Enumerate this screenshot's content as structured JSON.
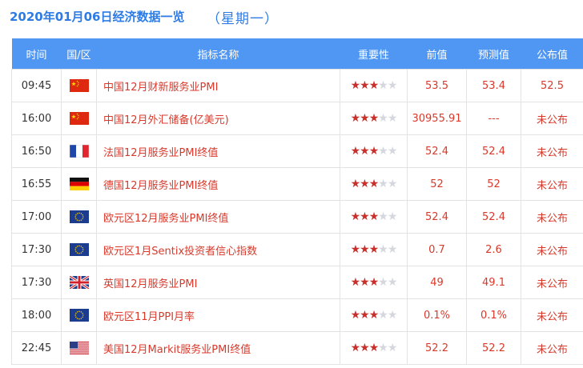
{
  "header": {
    "title": "2020年01月06日经济数据一览",
    "weekday": "（星期一）"
  },
  "columns": [
    "时间",
    "国/区",
    "指标名称",
    "重要性",
    "前值",
    "预测值",
    "公布值"
  ],
  "rows": [
    {
      "time": "09:45",
      "flag": "china-flag-icon",
      "indicator": "中国12月财新服务业PMI",
      "stars": 3,
      "prev": "53.5",
      "forecast": "53.4",
      "actual": "52.5"
    },
    {
      "time": "16:00",
      "flag": "china-flag-icon",
      "indicator": "中国12月外汇储备(亿美元)",
      "stars": 3,
      "prev": "30955.91",
      "forecast": "---",
      "actual": "未公布"
    },
    {
      "time": "16:50",
      "flag": "france-flag-icon",
      "indicator": "法国12月服务业PMI终值",
      "stars": 3,
      "prev": "52.4",
      "forecast": "52.4",
      "actual": "未公布"
    },
    {
      "time": "16:55",
      "flag": "germany-flag-icon",
      "indicator": "德国12月服务业PMI终值",
      "stars": 3,
      "prev": "52",
      "forecast": "52",
      "actual": "未公布"
    },
    {
      "time": "17:00",
      "flag": "eu-flag-icon",
      "indicator": "欧元区12月服务业PMI终值",
      "stars": 3,
      "prev": "52.4",
      "forecast": "52.4",
      "actual": "未公布"
    },
    {
      "time": "17:30",
      "flag": "eu-flag-icon",
      "indicator": "欧元区1月Sentix投资者信心指数",
      "stars": 3,
      "prev": "0.7",
      "forecast": "2.6",
      "actual": "未公布"
    },
    {
      "time": "17:30",
      "flag": "uk-flag-icon",
      "indicator": "英国12月服务业PMI",
      "stars": 3,
      "prev": "49",
      "forecast": "49.1",
      "actual": "未公布"
    },
    {
      "time": "18:00",
      "flag": "eu-flag-icon",
      "indicator": "欧元区11月PPI月率",
      "stars": 3,
      "prev": "0.1%",
      "forecast": "0.1%",
      "actual": "未公布"
    },
    {
      "time": "22:45",
      "flag": "us-flag-icon",
      "indicator": "美国12月Markit服务业PMI终值",
      "stars": 3,
      "prev": "52.2",
      "forecast": "52.2",
      "actual": "未公布"
    }
  ],
  "colors": {
    "accent": "#2d7be5",
    "header_bg": "#4f97f2",
    "value_red": "#d9392b",
    "star_on": "#c9302c",
    "star_off": "#d4d8de"
  }
}
